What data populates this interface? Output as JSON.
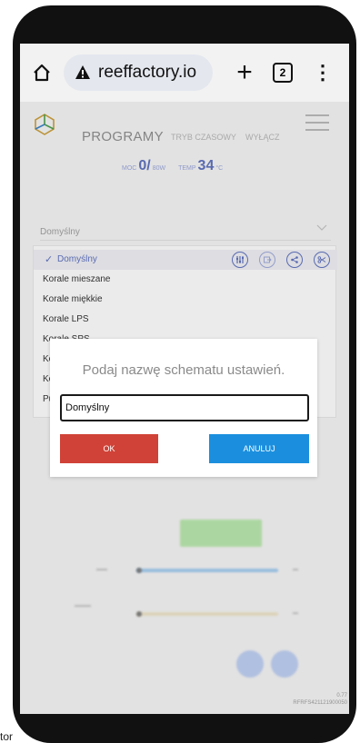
{
  "browser": {
    "url": "reeffactory.io",
    "tab_count": "2"
  },
  "nav": {
    "programs": "PROGRAMY",
    "time_mode": "TRYB CZASOWY",
    "off": "WYŁĄCZ"
  },
  "stats": {
    "power_label": "MOC",
    "power_value": "0/",
    "power_unit": "80W",
    "temp_label": "TEMP",
    "temp_value": "34",
    "temp_unit": "°C"
  },
  "profile_select": {
    "value": "Domyślny"
  },
  "schemes": [
    {
      "label": "Domyślny",
      "selected": true
    },
    {
      "label": "Korale mieszane"
    },
    {
      "label": "Korale miękkie"
    },
    {
      "label": "Korale LPS"
    },
    {
      "label": "Korale SPS"
    },
    {
      "label": "Ko"
    },
    {
      "label": "Ko"
    },
    {
      "label": "Pu"
    }
  ],
  "dialog": {
    "title": "Podaj nazwę schematu ustawień.",
    "input_value": "Domyślny",
    "ok_label": "OK",
    "cancel_label": "ANULUJ"
  },
  "footer": {
    "version": "0.77",
    "serial": "RFRFS421121900050"
  },
  "bottom_partial_text": "tor",
  "colors": {
    "accent": "#5d6fb8",
    "ok": "#d04237",
    "cancel": "#1b8fde"
  }
}
